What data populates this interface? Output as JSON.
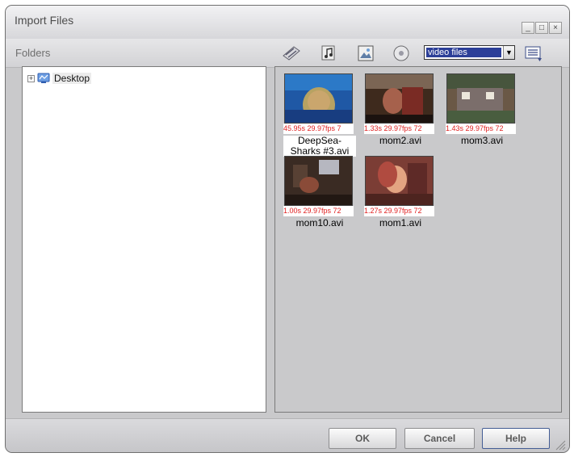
{
  "window": {
    "title": "Import Files"
  },
  "toolbar": {
    "folders_label": "Folders",
    "filter": {
      "selected": "video files"
    },
    "icons": [
      "video-film-icon",
      "music-note-icon",
      "image-icon",
      "disc-icon",
      "view-mode-icon"
    ]
  },
  "tree": {
    "root": {
      "label": "Desktop",
      "expander": "+"
    }
  },
  "files": [
    {
      "meta": "45.95s 29.97fps 7",
      "name": "DeepSea-Sharks #3.avi"
    },
    {
      "meta": "1.33s 29.97fps 72",
      "name": "mom2.avi"
    },
    {
      "meta": "1.43s 29.97fps 72",
      "name": "mom3.avi"
    },
    {
      "meta": "1.00s 29.97fps 72",
      "name": "mom10.avi"
    },
    {
      "meta": "1.27s 29.97fps 72",
      "name": "mom1.avi"
    }
  ],
  "buttons": {
    "ok": "OK",
    "cancel": "Cancel",
    "help": "Help"
  },
  "colors": {
    "meta_text": "#e02020",
    "selection": "#2c3f98"
  }
}
